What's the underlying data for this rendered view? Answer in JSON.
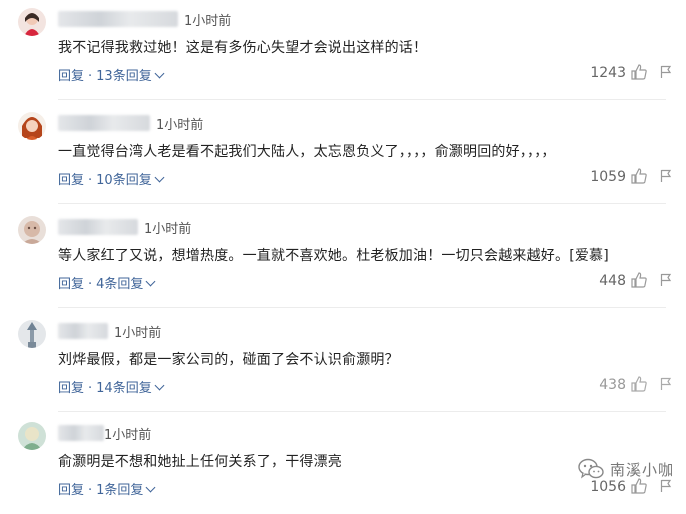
{
  "comments": [
    {
      "time": "1小时前",
      "text": "我不记得我救过她！这是有多伤心失望才会说出这样的话！",
      "reply_label": "回复",
      "sub_replies": "13条回复",
      "likes": "1243"
    },
    {
      "time": "1小时前",
      "text": "一直觉得台湾人老是看不起我们大陆人，太忘恩负义了，，，，俞灏明回的好，，，，",
      "reply_label": "回复",
      "sub_replies": "10条回复",
      "likes": "1059"
    },
    {
      "time": "1小时前",
      "text": "等人家红了又说，想增热度。一直就不喜欢她。杜老板加油！一切只会越来越好。[爱慕]",
      "reply_label": "回复",
      "sub_replies": "4条回复",
      "likes": "448"
    },
    {
      "time": "1小时前",
      "text": "刘烨最假，都是一家公司的，碰面了会不认识俞灏明？",
      "reply_label": "回复",
      "sub_replies": "14条回复",
      "likes": "438"
    },
    {
      "time": "1小时前",
      "text": "俞灏明是不想和她扯上任何关系了，干得漂亮",
      "reply_label": "回复",
      "sub_replies": "1条回复",
      "likes": "1056"
    }
  ],
  "watermark": "南溪小咖",
  "icons": {
    "like": "thumbs-up-icon",
    "report": "flag-icon",
    "expand": "chevron-down-icon",
    "watermark": "wechat-logo-icon"
  },
  "colors": {
    "link": "#406599",
    "like_count": "#666666"
  }
}
